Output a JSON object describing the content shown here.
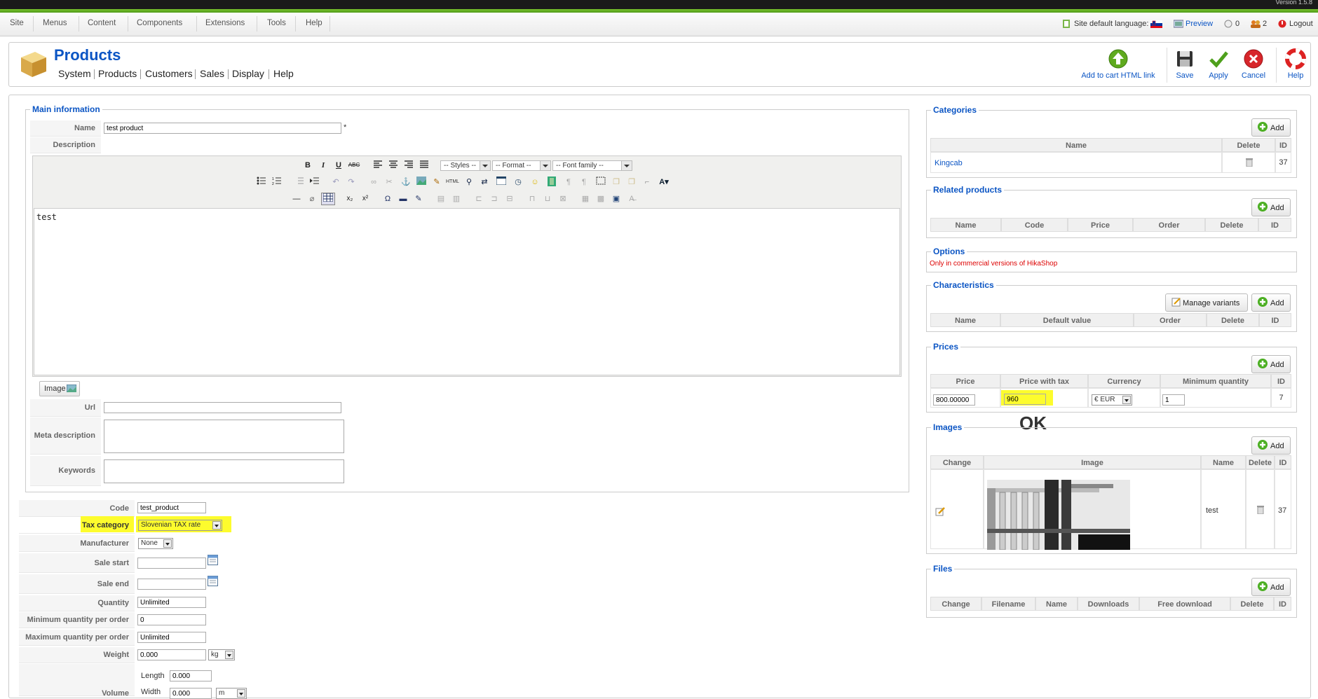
{
  "header": {
    "version": "Version 1.5.8"
  },
  "menubar": {
    "items": [
      "Site",
      "Menus",
      "Content",
      "Components",
      "Extensions",
      "Tools",
      "Help"
    ],
    "site_lang_label": "Site default language:",
    "preview": "Preview",
    "messages_count": "0",
    "users_count": "2",
    "logout": "Logout"
  },
  "toolbar": {
    "title": "Products",
    "submenu": [
      "System",
      "Products",
      "Customers",
      "Sales",
      "Display",
      "Help"
    ],
    "add_to_cart_link": "Add to cart HTML link",
    "save": "Save",
    "apply": "Apply",
    "cancel": "Cancel",
    "help": "Help"
  },
  "main_info": {
    "legend": "Main information",
    "name_label": "Name",
    "name_value": "test product",
    "required_mark": "*",
    "description_label": "Description",
    "editor_styles": "-- Styles --",
    "editor_format": "-- Format --",
    "editor_font": "-- Font family --",
    "editor_content": "test",
    "image_button": "Image",
    "url_label": "Url",
    "meta_label": "Meta description",
    "keywords_label": "Keywords"
  },
  "fields": {
    "code_label": "Code",
    "code_value": "test_product",
    "tax_label": "Tax category",
    "tax_value": "Slovenian TAX rate",
    "manufacturer_label": "Manufacturer",
    "manufacturer_value": "None",
    "sale_start_label": "Sale start",
    "sale_end_label": "Sale end",
    "quantity_label": "Quantity",
    "quantity_value": "Unlimited",
    "min_qty_label": "Minimum quantity per order",
    "min_qty_value": "0",
    "max_qty_label": "Maximum quantity per order",
    "max_qty_value": "Unlimited",
    "weight_label": "Weight",
    "weight_value": "0.000",
    "weight_unit": "kg",
    "volume_label": "Volume",
    "length_label": "Length",
    "length_value": "0.000",
    "width_label": "Width",
    "width_value": "0.000",
    "volume_unit": "m"
  },
  "categories": {
    "legend": "Categories",
    "add": "Add",
    "headers": [
      "Name",
      "Delete",
      "ID"
    ],
    "rows": [
      {
        "name": "Kingcab",
        "id": "37"
      }
    ]
  },
  "related": {
    "legend": "Related products",
    "add": "Add",
    "headers": [
      "Name",
      "Code",
      "Price",
      "Order",
      "Delete",
      "ID"
    ]
  },
  "options": {
    "legend": "Options",
    "note": "Only in commercial versions of HikaShop"
  },
  "characteristics": {
    "legend": "Characteristics",
    "manage": "Manage variants",
    "add": "Add",
    "headers": [
      "Name",
      "Default value",
      "Order",
      "Delete",
      "ID"
    ]
  },
  "prices": {
    "legend": "Prices",
    "add": "Add",
    "headers": [
      "Price",
      "Price with tax",
      "Currency",
      "Minimum quantity",
      "ID"
    ],
    "row": {
      "price": "800.00000",
      "price_tax": "960",
      "currency": "€ EUR",
      "min_qty": "1",
      "id": "7"
    },
    "ok_note": "OK"
  },
  "images": {
    "legend": "Images",
    "add": "Add",
    "headers": [
      "Change",
      "Image",
      "Name",
      "Delete",
      "ID"
    ],
    "row": {
      "name": "test",
      "id": "37"
    }
  },
  "files": {
    "legend": "Files",
    "add": "Add",
    "headers": [
      "Change",
      "Filename",
      "Name",
      "Downloads",
      "Free download",
      "Delete",
      "ID"
    ]
  },
  "colors": {
    "accent": "#0b55c4",
    "highlight": "#fdfc2d",
    "green": "#5faa1e"
  }
}
